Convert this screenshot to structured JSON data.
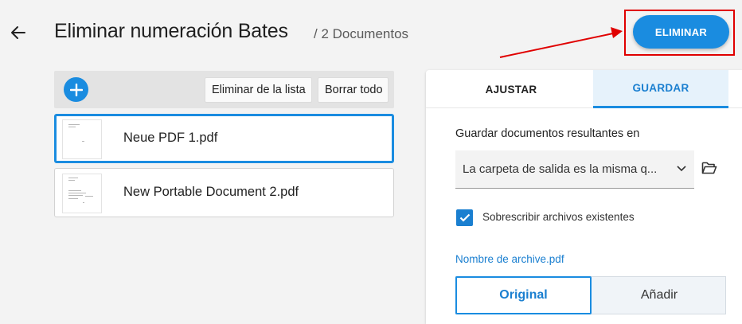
{
  "header": {
    "title": "Eliminar numeración Bates",
    "doc_count": "/ 2 Documentos",
    "primary_action": "ELIMINAR",
    "accent_color": "#1a8ce0",
    "annotation_color": "#e00000"
  },
  "file_list": {
    "toolbar": {
      "remove_label": "Eliminar de la lista",
      "clear_label": "Borrar todo"
    },
    "files": [
      {
        "name": "Neue PDF 1.pdf",
        "selected": true
      },
      {
        "name": "New Portable Document 2.pdf",
        "selected": false
      }
    ]
  },
  "settings": {
    "tabs": [
      {
        "label": "AJUSTAR",
        "active": false
      },
      {
        "label": "GUARDAR",
        "active": true
      }
    ],
    "save_location_label": "Guardar documentos resultantes en",
    "save_location_value": "La carpeta de salida es la misma q...",
    "overwrite_label": "Sobrescribir archivos existentes",
    "overwrite_checked": true,
    "filename_label": "Nombre de archive.pdf",
    "filename_options": [
      "Original",
      "Añadir"
    ],
    "filename_selected": "Original"
  }
}
